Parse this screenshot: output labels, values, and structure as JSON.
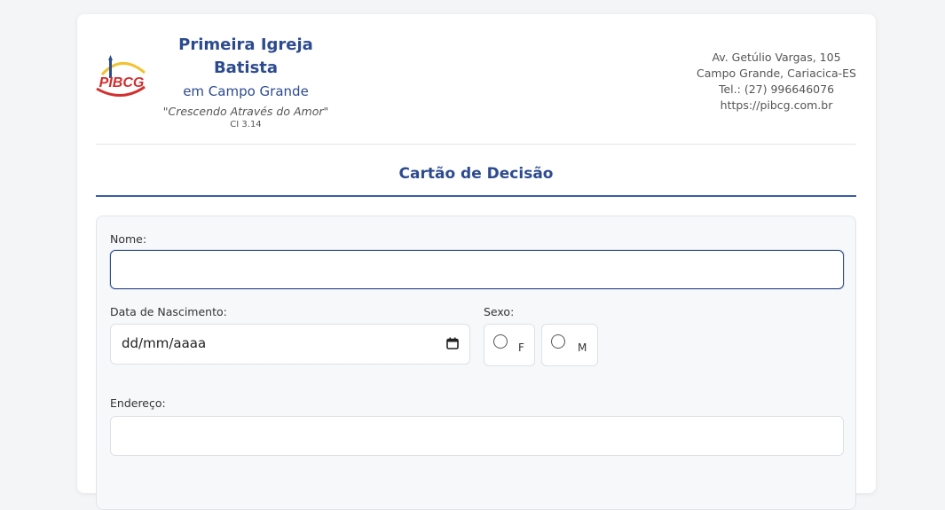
{
  "header": {
    "org_name_line1": "Primeira Igreja Batista",
    "org_name_line2": "em Campo Grande",
    "motto": "\"Crescendo Através do Amor\"",
    "code": "CI 3.14",
    "logo_text": "PIBCG",
    "address_line1": "Av. Getúlio Vargas, 105",
    "address_line2": "Campo Grande, Cariacica-ES",
    "phone": "Tel.: (27) 996646076",
    "website": "https://pibcg.com.br"
  },
  "form": {
    "title": "Cartão de Decisão",
    "name_label": "Nome:",
    "name_value": "",
    "birth_label": "Data de Nascimento:",
    "birth_placeholder": "dd/mm/aaaa",
    "sex_label": "Sexo:",
    "sex_options": [
      "F",
      "M"
    ],
    "address_label": "Endereço:",
    "address_value": ""
  },
  "colors": {
    "accent": "#2c4b8f",
    "logo_red": "#d32f2f",
    "logo_yellow": "#f2c230",
    "logo_blue": "#2c4b8f"
  },
  "icons": {
    "calendar": "calendar-icon",
    "logo": "church-logo-icon"
  }
}
